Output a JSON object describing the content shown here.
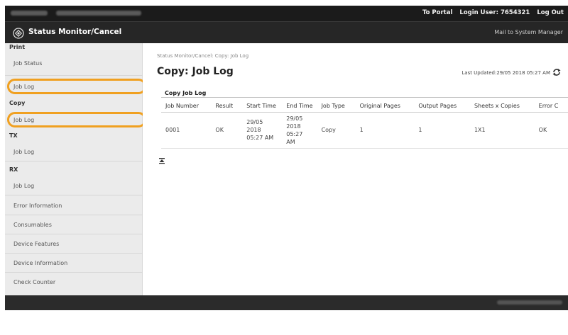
{
  "topbar": {
    "portal_link": "To Portal",
    "login_user": "Login User: 7654321",
    "logout": "Log Out"
  },
  "header": {
    "title": "Status Monitor/Cancel",
    "mail_link": "Mail to System Manager"
  },
  "sidebar": {
    "print": {
      "label": "Print",
      "items": [
        "Job Status",
        "Job Log"
      ]
    },
    "copy": {
      "label": "Copy",
      "items": [
        "Job Log"
      ]
    },
    "tx": {
      "label": "TX",
      "items": [
        "Job Log"
      ]
    },
    "rx": {
      "label": "RX",
      "items": [
        "Job Log"
      ]
    },
    "items": [
      "Error Information",
      "Consumables",
      "Device Features",
      "Device Information",
      "Check Counter"
    ]
  },
  "main": {
    "breadcrumb": "Status Monitor/Cancel: Copy: Job Log",
    "title": "Copy: Job Log",
    "last_updated": "Last Updated:29/05 2018 05:27 AM",
    "panel_title": "Copy Job Log",
    "table": {
      "headers": [
        "Job Number",
        "Result",
        "Start Time",
        "End Time",
        "Job Type",
        "Original Pages",
        "Output Pages",
        "Sheets x Copies",
        "Error C"
      ],
      "rows": [
        [
          "0001",
          "OK",
          "29/05 2018 05:27 AM",
          "29/05 2018 05:27 AM",
          "Copy",
          "1",
          "1",
          "1X1",
          "OK"
        ]
      ]
    }
  },
  "colors": {
    "highlight": "#f0a020",
    "topbar": "#1b1b1b",
    "titlebar": "#262626",
    "sidebar": "#ebebeb"
  }
}
